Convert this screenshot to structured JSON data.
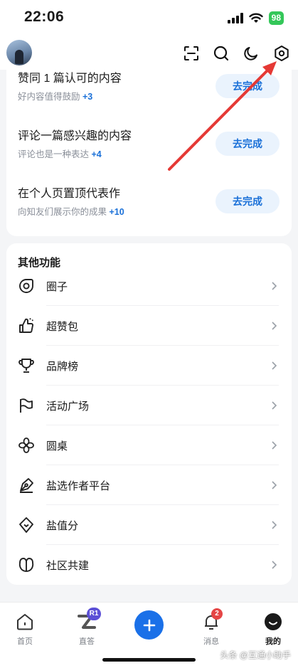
{
  "status_bar": {
    "time": "22:06",
    "battery": "98"
  },
  "tasks": [
    {
      "title": "赞同 1 篇认可的内容",
      "subtitle": "好内容值得鼓励",
      "points": "+3",
      "button": "去完成"
    },
    {
      "title": "评论一篇感兴趣的内容",
      "subtitle": "评论也是一种表达",
      "points": "+4",
      "button": "去完成"
    },
    {
      "title": "在个人页置顶代表作",
      "subtitle": "向知友们展示你的成果",
      "points": "+10",
      "button": "去完成"
    }
  ],
  "other_features": {
    "title": "其他功能",
    "items": [
      {
        "label": "圈子",
        "icon": "circle-group-icon"
      },
      {
        "label": "超赞包",
        "icon": "thumbs-up-icon"
      },
      {
        "label": "品牌榜",
        "icon": "trophy-icon"
      },
      {
        "label": "活动广场",
        "icon": "flag-icon"
      },
      {
        "label": "圆桌",
        "icon": "flower-icon"
      },
      {
        "label": "盐选作者平台",
        "icon": "pen-nib-icon"
      },
      {
        "label": "盐值分",
        "icon": "diamond-icon"
      },
      {
        "label": "社区共建",
        "icon": "leaf-icon"
      }
    ]
  },
  "bottom_nav": {
    "home": "首页",
    "zhida": "直答",
    "zhida_badge": "R1",
    "messages": "消息",
    "messages_badge": "2",
    "me": "我的"
  },
  "watermark": "头条 @互通小助手",
  "colors": {
    "accent": "#1a70d8",
    "annotation_arrow": "#e53935"
  }
}
